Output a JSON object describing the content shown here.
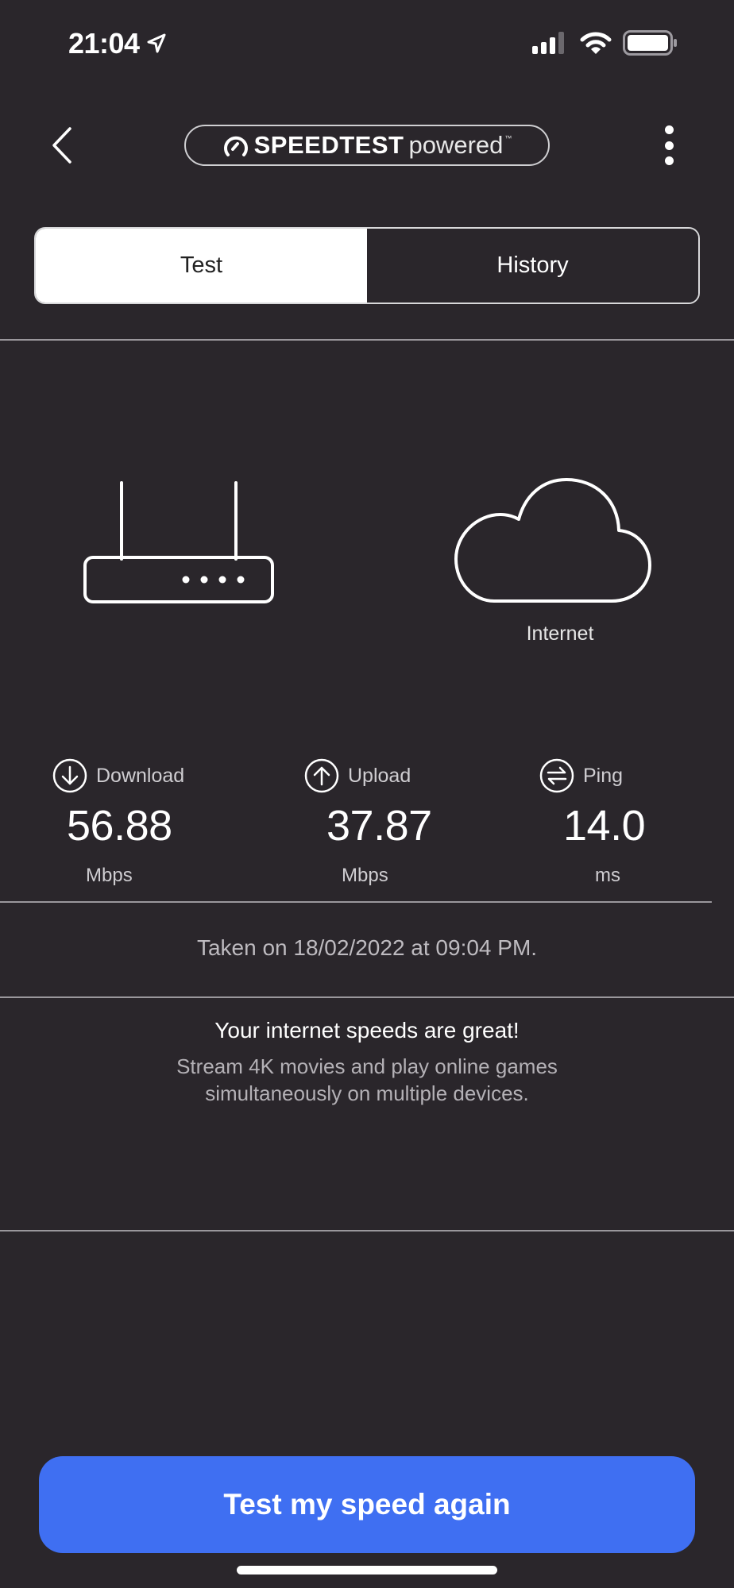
{
  "status_bar": {
    "time": "21:04",
    "location_icon": "location-arrow-icon",
    "signal_icon": "cellular-signal-icon",
    "wifi_icon": "wifi-icon",
    "battery_icon": "battery-icon"
  },
  "nav": {
    "back_icon": "chevron-left-icon",
    "logo": {
      "brand": "SPEEDTEST",
      "suffix": "powered",
      "trademark": "™",
      "icon": "speedometer-icon"
    },
    "more_icon": "more-vertical-icon"
  },
  "tabs": [
    {
      "label": "Test",
      "active": true
    },
    {
      "label": "History",
      "active": false
    }
  ],
  "diagram": {
    "router_icon": "router-icon",
    "cloud_icon": "cloud-icon",
    "internet_label": "Internet"
  },
  "metrics": [
    {
      "label": "Download",
      "value": "56.88",
      "unit": "Mbps",
      "icon": "arrow-down-circle-icon"
    },
    {
      "label": "Upload",
      "value": "37.87",
      "unit": "Mbps",
      "icon": "arrow-up-circle-icon"
    },
    {
      "label": "Ping",
      "value": "14.0",
      "unit": "ms",
      "icon": "swap-arrows-circle-icon"
    }
  ],
  "taken_on": "Taken on 18/02/2022 at 09:04 PM.",
  "verdict": {
    "title": "Your internet speeds are great!",
    "body_line1": "Stream 4K movies and play online games",
    "body_line2": "simultaneously on multiple devices."
  },
  "cta": {
    "label": "Test my speed again"
  },
  "colors": {
    "background": "#2a262b",
    "accent": "#3f6ff2",
    "divider": "#9a979c"
  }
}
